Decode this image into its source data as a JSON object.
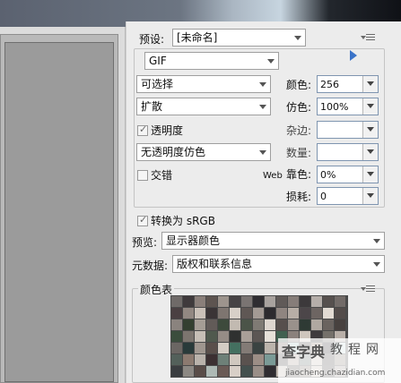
{
  "preset": {
    "label": "预设:",
    "value": "[未命名]"
  },
  "format": {
    "value": "GIF"
  },
  "reduction": {
    "value": "可选择"
  },
  "dither_algo": {
    "value": "扩散"
  },
  "transparency": {
    "label": "透明度",
    "checked": true
  },
  "matte_dither": {
    "value": "无透明度仿色"
  },
  "interlaced": {
    "label": "交错",
    "checked": false
  },
  "colors": {
    "label": "颜色:",
    "value": "256"
  },
  "dither": {
    "label": "仿色:",
    "value": "100%"
  },
  "matte": {
    "label": "杂边:",
    "value": ""
  },
  "amount": {
    "label": "数量:",
    "value": ""
  },
  "web_snap": {
    "prefix": "Web",
    "label": "靠色:",
    "value": "0%"
  },
  "lossy": {
    "label": "损耗:",
    "value": "0"
  },
  "convert_srgb": {
    "label": "转换为 sRGB",
    "checked": true
  },
  "preview": {
    "label": "预览:",
    "value": "显示器颜色"
  },
  "metadata": {
    "label": "元数据:",
    "value": "版权和联系信息"
  },
  "color_table": {
    "label": "颜色表"
  },
  "watermark": {
    "brand": "查字典",
    "site": "教程网",
    "url": "jiaocheng.chazidian.com"
  },
  "swatches": [
    "#6f6a68",
    "#3f3a3c",
    "#8a7f7a",
    "#5d5450",
    "#9d948d",
    "#474345",
    "#7a7472",
    "#2f2d31",
    "#a8a29e",
    "#605a58",
    "#867d79",
    "#3c393b",
    "#b5aea9",
    "#56504e",
    "#726b68",
    "#4a4042",
    "#928882",
    "#c9c0b8",
    "#3a3436",
    "#7e7570",
    "#d8d0c8",
    "#5f5754",
    "#a39a94",
    "#2c2a2e",
    "#8f8580",
    "#b7aea6",
    "#4c4649",
    "#6d6562",
    "#e2dbd3",
    "#534c4a",
    "#8a837e",
    "#344030",
    "#a59d95",
    "#625b58",
    "#3d4a3c",
    "#c2bab1",
    "#4b5448",
    "#7f7a74",
    "#ded6cf",
    "#574f4d",
    "#9a918b",
    "#2e3a34",
    "#b0a8a1",
    "#6a635f",
    "#48413f",
    "#3b4d3d",
    "#7c756f",
    "#c6beb6",
    "#50594e",
    "#958c86",
    "#2f3130",
    "#a99f98",
    "#5c5654",
    "#e6e0d9",
    "#406050",
    "#8a817c",
    "#cfc6bd",
    "#3e3b3d",
    "#74706a",
    "#b8afa8",
    "#6b6663",
    "#293a3a",
    "#9f968f",
    "#5a4f4b",
    "#d4ccc4",
    "#447060",
    "#837b76",
    "#3a4342",
    "#bcb4ac",
    "#6c625e",
    "#a4c4c0",
    "#4a4543",
    "#917f74",
    "#2d2b2f",
    "#c8d8d8",
    "#53605a",
    "#8c7a70",
    "#b9b2ab",
    "#3c3032",
    "#6e8078",
    "#d0c8bf",
    "#5a524f",
    "#9c8e86",
    "#7a9a96",
    "#3f3b3d",
    "#a99d94",
    "#627068",
    "#cabfb6",
    "#4c4447",
    "#878079",
    "#3a3d40",
    "#8c8883",
    "#594c48",
    "#aeb9b5",
    "#6a5a55",
    "#d8cfc7",
    "#44504e",
    "#998e87",
    "#2f2c30",
    "#bfb6ae",
    "#5e5753",
    "#807670",
    "#c8c0b8",
    "#4d4a48",
    "#a59c96"
  ]
}
